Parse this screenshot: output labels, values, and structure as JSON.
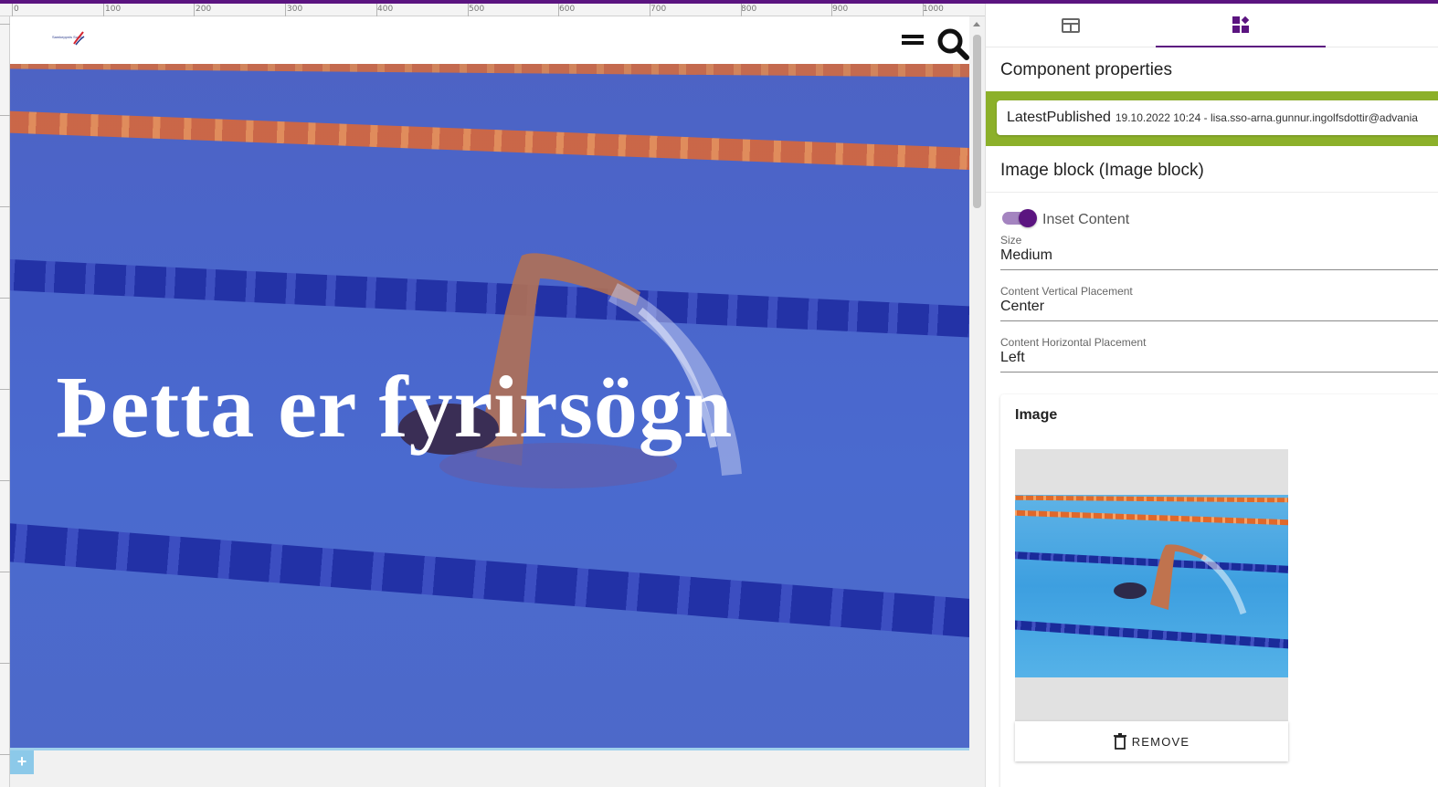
{
  "editor": {
    "ruler_labels": [
      "0",
      "100",
      "200",
      "300",
      "400",
      "500",
      "600",
      "700",
      "800",
      "900",
      "1000"
    ],
    "logo_text": "Samkeppnis Sund",
    "hero_heading": "Þetta er fyrirsögn",
    "add_button": "+"
  },
  "panel": {
    "tabs": [
      {
        "icon": "layout-icon"
      },
      {
        "icon": "components-icon"
      },
      {
        "icon": "lightning-icon"
      }
    ],
    "title": "Component properties",
    "status": {
      "name": "LatestPublished",
      "meta": "19.10.2022 10:24 - lisa.sso-arna.gunnur.ingolfsdottir@advania"
    },
    "block_title": "Image block (Image block)",
    "inset_toggle": {
      "label": "Inset Content",
      "on": true
    },
    "fields": [
      {
        "label": "Size",
        "value": "Medium"
      },
      {
        "label": "Content Vertical Placement",
        "value": "Center"
      },
      {
        "label": "Content Horizontal Placement",
        "value": "Left"
      }
    ],
    "image_card": {
      "title": "Image",
      "remove_label": "REMOVE"
    }
  },
  "colors": {
    "accent": "#5b1480",
    "status_bar": "#8cb02a",
    "hero_overlay": "#4a66cc"
  }
}
